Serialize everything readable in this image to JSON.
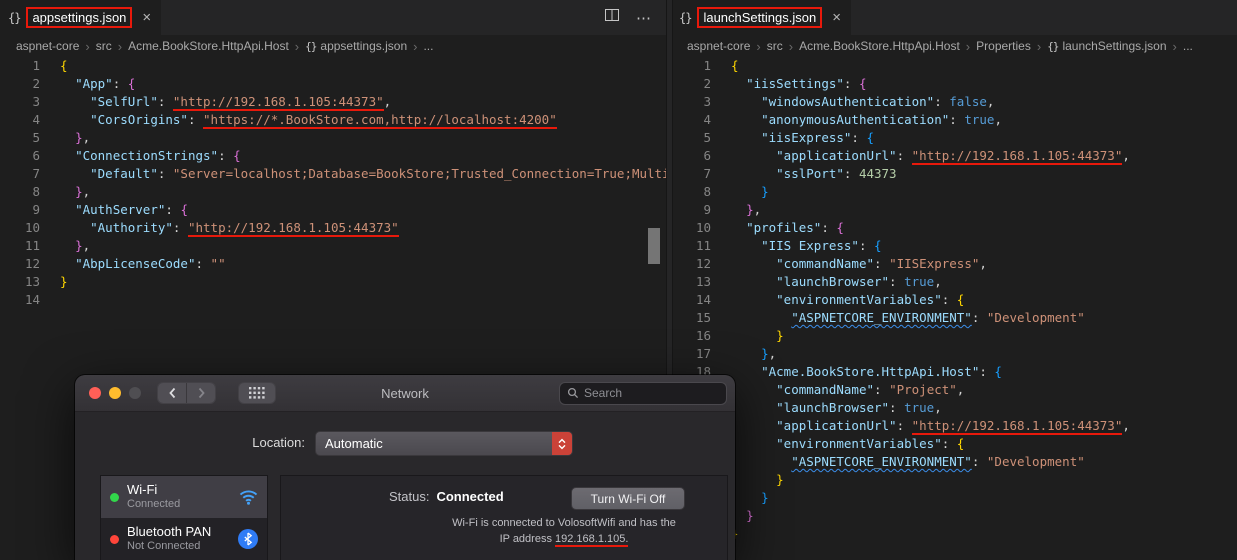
{
  "glyphs": {
    "close": "×",
    "more": "⋯",
    "chevron": "›",
    "json_icon": "{}"
  },
  "panes": {
    "left": {
      "tab": "appsettings.json",
      "breadcrumb": [
        "aspnet-core",
        "src",
        "Acme.BookStore.HttpApi.Host"
      ],
      "file": "appsettings.json",
      "more": "...",
      "lines": [
        [
          [
            "{",
            "b1"
          ]
        ],
        [
          [
            "  ",
            "w"
          ],
          [
            "\"App\"",
            "k"
          ],
          [
            ": ",
            "d"
          ],
          [
            "{",
            "b2"
          ]
        ],
        [
          [
            "    ",
            "w"
          ],
          [
            "\"SelfUrl\"",
            "k"
          ],
          [
            ": ",
            "d"
          ],
          [
            "\"http://192.168.1.105:44373\"",
            "s",
            "ru"
          ],
          [
            ",",
            "d"
          ]
        ],
        [
          [
            "    ",
            "w"
          ],
          [
            "\"CorsOrigins\"",
            "k"
          ],
          [
            ": ",
            "d"
          ],
          [
            "\"https://*.BookStore.com,http://localhost:4200\"",
            "s",
            "ru"
          ]
        ],
        [
          [
            "  ",
            "w"
          ],
          [
            "}",
            "b2"
          ],
          [
            ",",
            "d"
          ]
        ],
        [
          [
            "  ",
            "w"
          ],
          [
            "\"ConnectionStrings\"",
            "k"
          ],
          [
            ": ",
            "d"
          ],
          [
            "{",
            "b2"
          ]
        ],
        [
          [
            "    ",
            "w"
          ],
          [
            "\"Default\"",
            "k"
          ],
          [
            ": ",
            "d"
          ],
          [
            "\"Server=localhost;Database=BookStore;Trusted_Connection=True;Multipl",
            "s"
          ]
        ],
        [
          [
            "  ",
            "w"
          ],
          [
            "}",
            "b2"
          ],
          [
            ",",
            "d"
          ]
        ],
        [
          [
            "  ",
            "w"
          ],
          [
            "\"AuthServer\"",
            "k"
          ],
          [
            ": ",
            "d"
          ],
          [
            "{",
            "b2"
          ]
        ],
        [
          [
            "    ",
            "w"
          ],
          [
            "\"Authority\"",
            "k"
          ],
          [
            ": ",
            "d"
          ],
          [
            "\"http://192.168.1.105:44373\"",
            "s",
            "ru"
          ]
        ],
        [
          [
            "  ",
            "w"
          ],
          [
            "}",
            "b2"
          ],
          [
            ",",
            "d"
          ]
        ],
        [
          [
            "  ",
            "w"
          ],
          [
            "\"AbpLicenseCode\"",
            "k"
          ],
          [
            ": ",
            "d"
          ],
          [
            "\"\"",
            "s"
          ]
        ],
        [
          [
            "}",
            "b1"
          ]
        ],
        []
      ]
    },
    "right": {
      "tab": "launchSettings.json",
      "breadcrumb": [
        "aspnet-core",
        "src",
        "Acme.BookStore.HttpApi.Host",
        "Properties"
      ],
      "file": "launchSettings.json",
      "more": "...",
      "lines": [
        [
          [
            "{",
            "b1"
          ]
        ],
        [
          [
            "  ",
            "w"
          ],
          [
            "\"iisSettings\"",
            "k"
          ],
          [
            ": ",
            "d"
          ],
          [
            "{",
            "b2"
          ]
        ],
        [
          [
            "    ",
            "w"
          ],
          [
            "\"windowsAuthentication\"",
            "k"
          ],
          [
            ": ",
            "d"
          ],
          [
            "false",
            "t"
          ],
          [
            ",",
            "d"
          ]
        ],
        [
          [
            "    ",
            "w"
          ],
          [
            "\"anonymousAuthentication\"",
            "k"
          ],
          [
            ": ",
            "d"
          ],
          [
            "true",
            "t"
          ],
          [
            ",",
            "d"
          ]
        ],
        [
          [
            "    ",
            "w"
          ],
          [
            "\"iisExpress\"",
            "k"
          ],
          [
            ": ",
            "d"
          ],
          [
            "{",
            "b3"
          ]
        ],
        [
          [
            "      ",
            "w"
          ],
          [
            "\"applicationUrl\"",
            "k"
          ],
          [
            ": ",
            "d"
          ],
          [
            "\"http://192.168.1.105:44373\"",
            "s",
            "ru"
          ],
          [
            ",",
            "d"
          ]
        ],
        [
          [
            "      ",
            "w"
          ],
          [
            "\"sslPort\"",
            "k"
          ],
          [
            ": ",
            "d"
          ],
          [
            "44373",
            "n"
          ]
        ],
        [
          [
            "    ",
            "w"
          ],
          [
            "}",
            "b3"
          ]
        ],
        [
          [
            "  ",
            "w"
          ],
          [
            "}",
            "b2"
          ],
          [
            ",",
            "d"
          ]
        ],
        [
          [
            "  ",
            "w"
          ],
          [
            "\"profiles\"",
            "k"
          ],
          [
            ": ",
            "d"
          ],
          [
            "{",
            "b2"
          ]
        ],
        [
          [
            "    ",
            "w"
          ],
          [
            "\"IIS Express\"",
            "k"
          ],
          [
            ": ",
            "d"
          ],
          [
            "{",
            "b3"
          ]
        ],
        [
          [
            "      ",
            "w"
          ],
          [
            "\"commandName\"",
            "k"
          ],
          [
            ": ",
            "d"
          ],
          [
            "\"IISExpress\"",
            "s"
          ],
          [
            ",",
            "d"
          ]
        ],
        [
          [
            "      ",
            "w"
          ],
          [
            "\"launchBrowser\"",
            "k"
          ],
          [
            ": ",
            "d"
          ],
          [
            "true",
            "t"
          ],
          [
            ",",
            "d"
          ]
        ],
        [
          [
            "      ",
            "w"
          ],
          [
            "\"environmentVariables\"",
            "k"
          ],
          [
            ": ",
            "d"
          ],
          [
            "{",
            "b4"
          ]
        ],
        [
          [
            "        ",
            "w"
          ],
          [
            "\"ASPNETCORE_ENVIRONMENT\"",
            "k",
            "bw"
          ],
          [
            ": ",
            "d"
          ],
          [
            "\"Development\"",
            "s"
          ]
        ],
        [
          [
            "      ",
            "w"
          ],
          [
            "}",
            "b4"
          ]
        ],
        [
          [
            "    ",
            "w"
          ],
          [
            "}",
            "b3"
          ],
          [
            ",",
            "d"
          ]
        ],
        [
          [
            "    ",
            "w"
          ],
          [
            "\"Acme.BookStore.HttpApi.Host\"",
            "k"
          ],
          [
            ": ",
            "d"
          ],
          [
            "{",
            "b3"
          ]
        ],
        [
          [
            "      ",
            "w"
          ],
          [
            "\"commandName\"",
            "k"
          ],
          [
            ": ",
            "d"
          ],
          [
            "\"Project\"",
            "s"
          ],
          [
            ",",
            "d"
          ]
        ],
        [
          [
            "      ",
            "w"
          ],
          [
            "\"launchBrowser\"",
            "k"
          ],
          [
            ": ",
            "d"
          ],
          [
            "true",
            "t"
          ],
          [
            ",",
            "d"
          ]
        ],
        [
          [
            "      ",
            "w"
          ],
          [
            "\"applicationUrl\"",
            "k"
          ],
          [
            ": ",
            "d"
          ],
          [
            "\"http://192.168.1.105:44373\"",
            "s",
            "ru"
          ],
          [
            ",",
            "d"
          ]
        ],
        [
          [
            "      ",
            "w"
          ],
          [
            "\"environmentVariables\"",
            "k"
          ],
          [
            ": ",
            "d"
          ],
          [
            "{",
            "b4"
          ]
        ],
        [
          [
            "        ",
            "w"
          ],
          [
            "\"ASPNETCORE_ENVIRONMENT\"",
            "k",
            "bw"
          ],
          [
            ": ",
            "d"
          ],
          [
            "\"Development\"",
            "s"
          ]
        ],
        [
          [
            "      ",
            "w"
          ],
          [
            "}",
            "b4"
          ]
        ],
        [
          [
            "    ",
            "w"
          ],
          [
            "}",
            "b3"
          ]
        ],
        [
          [
            "  ",
            "w"
          ],
          [
            "}",
            "b2"
          ]
        ],
        [
          [
            "}",
            "b1"
          ]
        ]
      ]
    }
  },
  "network": {
    "title": "Network",
    "search_placeholder": "Search",
    "location_label": "Location:",
    "location_value": "Automatic",
    "sidebar": [
      {
        "name": "Wi-Fi",
        "status": "Connected",
        "dot_color": "#32d74b"
      },
      {
        "name": "Bluetooth PAN",
        "status": "Not Connected",
        "dot_color": "#ff453a"
      }
    ],
    "status_label": "Status:",
    "status_value": "Connected",
    "wifi_off_button": "Turn Wi-Fi Off",
    "description_line1": "Wi-Fi is connected to VolosoftWifi and has the",
    "description_line2_prefix": "IP address ",
    "description_ip": "192.168.1.105."
  },
  "colors": {
    "annotation_red": "#e8190b",
    "accent_red": "#cb4238",
    "wifi_blue": "#44a2f8",
    "bluetooth_blue": "#2f7cf6"
  }
}
